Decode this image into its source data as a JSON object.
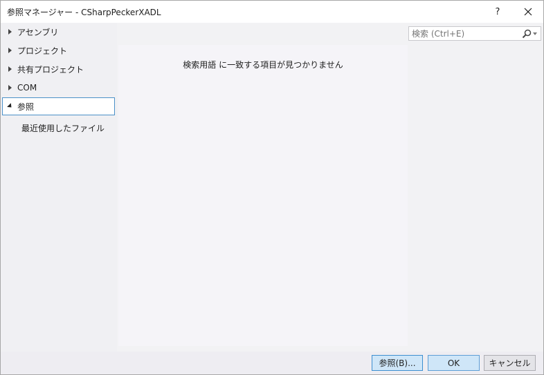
{
  "window": {
    "title": "参照マネージャー - CSharpPeckerXADL",
    "help_label": "?"
  },
  "sidebar": {
    "items": [
      {
        "label": "アセンブリ",
        "expanded": false
      },
      {
        "label": "プロジェクト",
        "expanded": false
      },
      {
        "label": "共有プロジェクト",
        "expanded": false
      },
      {
        "label": "COM",
        "expanded": false
      },
      {
        "label": "参照",
        "expanded": true,
        "selected": true
      }
    ],
    "sub_item": "最近使用したファイル"
  },
  "search": {
    "placeholder": "検索 (Ctrl+E)"
  },
  "main": {
    "empty_message": "検索用語  に一致する項目が見つかりません"
  },
  "footer": {
    "browse_label": "参照(B)...",
    "ok_label": "OK",
    "cancel_label": "キャンセル"
  },
  "colors": {
    "selection_border": "#4a90c8",
    "primary_button_bg": "#cfe6f8",
    "primary_button_border": "#3c8ed0"
  }
}
